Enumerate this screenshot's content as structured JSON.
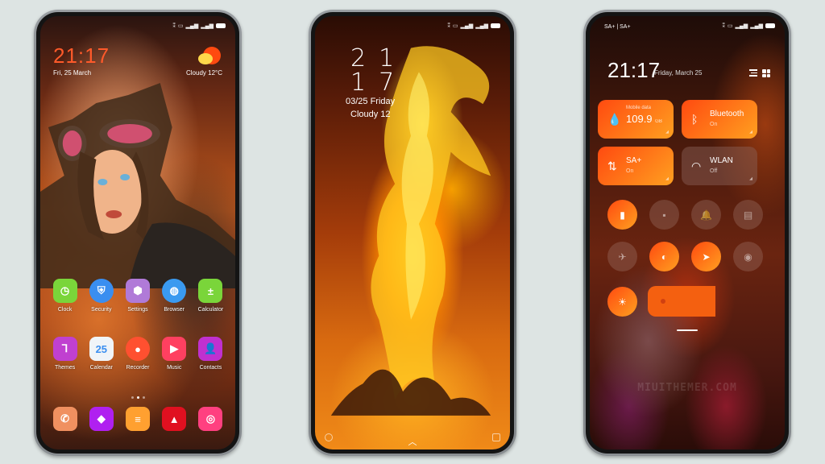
{
  "phones": {
    "home": {
      "clock": "21:17",
      "date": "Fri, 25 March",
      "weather": "Cloudy  12°C",
      "apps_row1": [
        {
          "label": "Clock",
          "icon": "clock-icon",
          "color": "#7ad53a"
        },
        {
          "label": "Security",
          "icon": "shield-icon",
          "color": "#3a8ef0"
        },
        {
          "label": "Settings",
          "icon": "hexagon-nut-icon",
          "color": "#b07ad8"
        },
        {
          "label": "Browser",
          "icon": "globe-icon",
          "color": "#3a9af0"
        },
        {
          "label": "Calculator",
          "icon": "calculator-icon",
          "color": "#7ad53a"
        }
      ],
      "apps_row2": [
        {
          "label": "Themes",
          "icon": "paint-roller-icon",
          "color": "#c040d0"
        },
        {
          "label": "Calendar",
          "icon": "calendar-icon",
          "color": "#f0f4f8",
          "text": "25"
        },
        {
          "label": "Recorder",
          "icon": "recorder-icon",
          "color": "#ff5030"
        },
        {
          "label": "Music",
          "icon": "music-icon",
          "color": "#ff4060"
        },
        {
          "label": "Contacts",
          "icon": "contact-icon",
          "color": "#c030d0"
        }
      ],
      "dock": [
        {
          "icon": "phone-icon",
          "color": "#f09060"
        },
        {
          "icon": "messages-icon",
          "color": "#b020f0"
        },
        {
          "icon": "notes-icon",
          "color": "#ffa030"
        },
        {
          "icon": "gallery-icon",
          "color": "#e01020"
        },
        {
          "icon": "camera-icon",
          "color": "#ff4080"
        }
      ],
      "page_count": 3,
      "active_page": 2
    },
    "lock": {
      "clock_hours": "21",
      "clock_minutes": "17",
      "date": "03/25 Friday",
      "weather": "Cloudy  12"
    },
    "control_center": {
      "carrier": "SA+ | SA+",
      "clock": "21:17",
      "date": "Friday, March 25",
      "tiles": [
        {
          "small": "Mobile data",
          "value": "109.9",
          "unit": "GB",
          "icon": "water-drop-icon",
          "state": "on"
        },
        {
          "title": "Bluetooth",
          "sub": "On",
          "icon": "bluetooth-icon",
          "state": "on"
        },
        {
          "title": "SA+",
          "sub": "On",
          "icon": "sa-plus-icon",
          "state": "on"
        },
        {
          "title": "WLAN",
          "sub": "Off",
          "icon": "wifi-icon",
          "state": "off"
        }
      ],
      "toggles": [
        {
          "name": "vibrate",
          "icon": "vibrate-icon",
          "glyph": "▮",
          "state": "on"
        },
        {
          "name": "flashlight",
          "icon": "flashlight-icon",
          "glyph": "▪",
          "state": "off"
        },
        {
          "name": "mute",
          "icon": "bell-icon",
          "glyph": "🔔",
          "state": "off"
        },
        {
          "name": "screenshot",
          "icon": "screenshot-icon",
          "glyph": "▤",
          "state": "off"
        },
        {
          "name": "airplane",
          "icon": "airplane-icon",
          "glyph": "✈",
          "state": "off"
        },
        {
          "name": "dark-mode",
          "icon": "contrast-icon",
          "glyph": "◐",
          "state": "on"
        },
        {
          "name": "location",
          "icon": "location-arrow-icon",
          "glyph": "➤",
          "state": "on"
        },
        {
          "name": "reading-mode",
          "icon": "eye-icon",
          "glyph": "◉",
          "state": "off"
        }
      ],
      "brightness_toggle": {
        "icon": "sun-icon",
        "glyph": "☀",
        "state": "on"
      },
      "watermark": "MIUITHEMER.COM"
    }
  }
}
